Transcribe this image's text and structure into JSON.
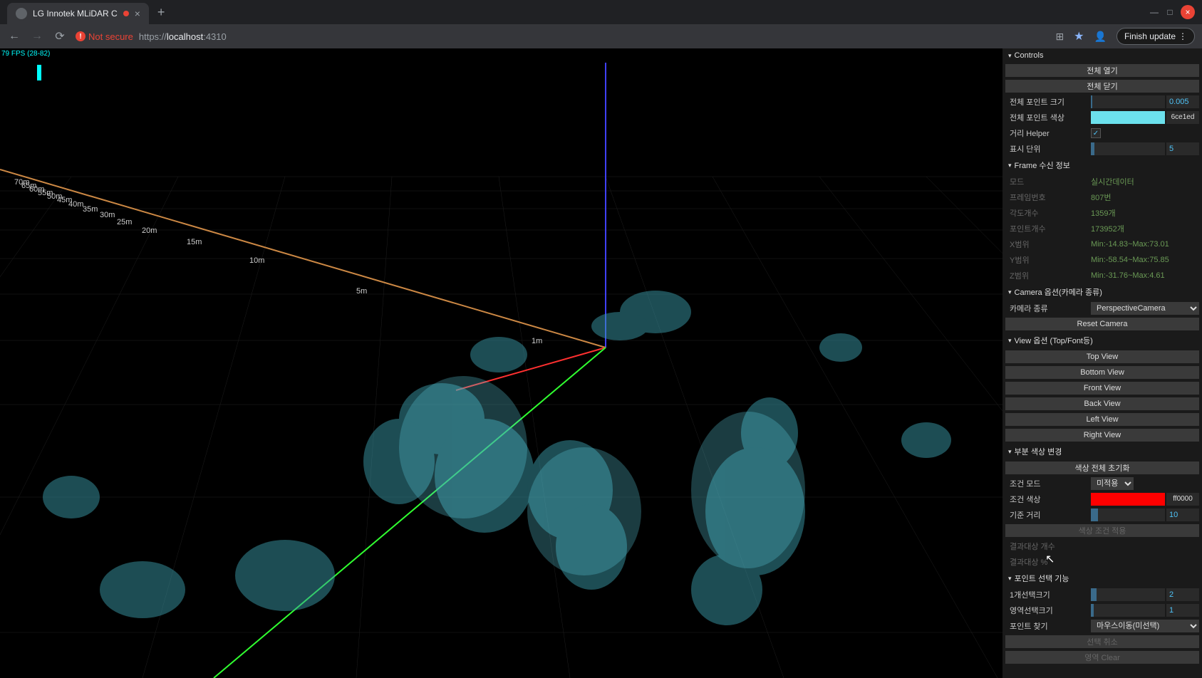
{
  "browser": {
    "tab_title": "LG Innotek MLiDAR C",
    "not_secure": "Not secure",
    "url_protocol": "https://",
    "url_host": "localhost",
    "url_port": ":4310",
    "finish_update": "Finish update"
  },
  "fps": {
    "text": "79 FPS (28-82)"
  },
  "distances": [
    "1m",
    "5m",
    "10m",
    "15m",
    "20m",
    "25m",
    "30m",
    "35m",
    "40m",
    "45m",
    "50m",
    "55m",
    "60m",
    "65m",
    "70m"
  ],
  "panel": {
    "controls": {
      "title": "Controls",
      "open_all": "전체 열기",
      "close_all": "전체 닫기",
      "point_size_label": "전체 포인트 크기",
      "point_size_value": "0.005",
      "point_color_label": "전체 포인트 색상",
      "point_color_value": "6ce1ed",
      "point_color_hex": "#6ce1ed",
      "distance_helper_label": "거리 Helper",
      "distance_helper_checked": true,
      "display_unit_label": "표시 단위",
      "display_unit_value": "5"
    },
    "frame_info": {
      "title": "Frame 수신 정보",
      "mode_label": "모드",
      "mode_value": "실시간데이터",
      "frame_no_label": "프레임번호",
      "frame_no_value": "807번",
      "angle_count_label": "각도개수",
      "angle_count_value": "1359개",
      "point_count_label": "포인트개수",
      "point_count_value": "173952개",
      "x_range_label": "X범위",
      "x_range_value": "Min:-14.83~Max:73.01",
      "y_range_label": "Y범위",
      "y_range_value": "Min:-58.54~Max:75.85",
      "z_range_label": "Z범위",
      "z_range_value": "Min:-31.76~Max:4.61"
    },
    "camera": {
      "title": "Camera 옵션(카메라 종류)",
      "type_label": "카메라 종류",
      "type_value": "PerspectiveCamera",
      "reset": "Reset Camera"
    },
    "view": {
      "title": "View 옵션 (Top/Font등)",
      "top": "Top View",
      "bottom": "Bottom View",
      "front": "Front View",
      "back": "Back View",
      "left": "Left View",
      "right": "Right View"
    },
    "color_change": {
      "title": "부분 색상 변경",
      "reset_all": "색상 전체 초기화",
      "condition_mode_label": "조건 모드",
      "condition_mode_value": "미적용",
      "condition_color_label": "조건 색상",
      "condition_color_value": "ff0000",
      "condition_color_hex": "#ff0000",
      "base_distance_label": "기준 거리",
      "base_distance_value": "10",
      "apply": "색상 조건 적용",
      "result_count_label": "결과대상 개수",
      "result_pct_label": "결과대상 %"
    },
    "point_select": {
      "title": "포인트 선택 기능",
      "single_size_label": "1개선택크기",
      "single_size_value": "2",
      "area_size_label": "영역선택크기",
      "area_size_value": "1",
      "find_label": "포인트 찾기",
      "find_value": "마우스이동(미선택)",
      "cancel": "선택 취소",
      "clear": "영역 Clear"
    }
  }
}
